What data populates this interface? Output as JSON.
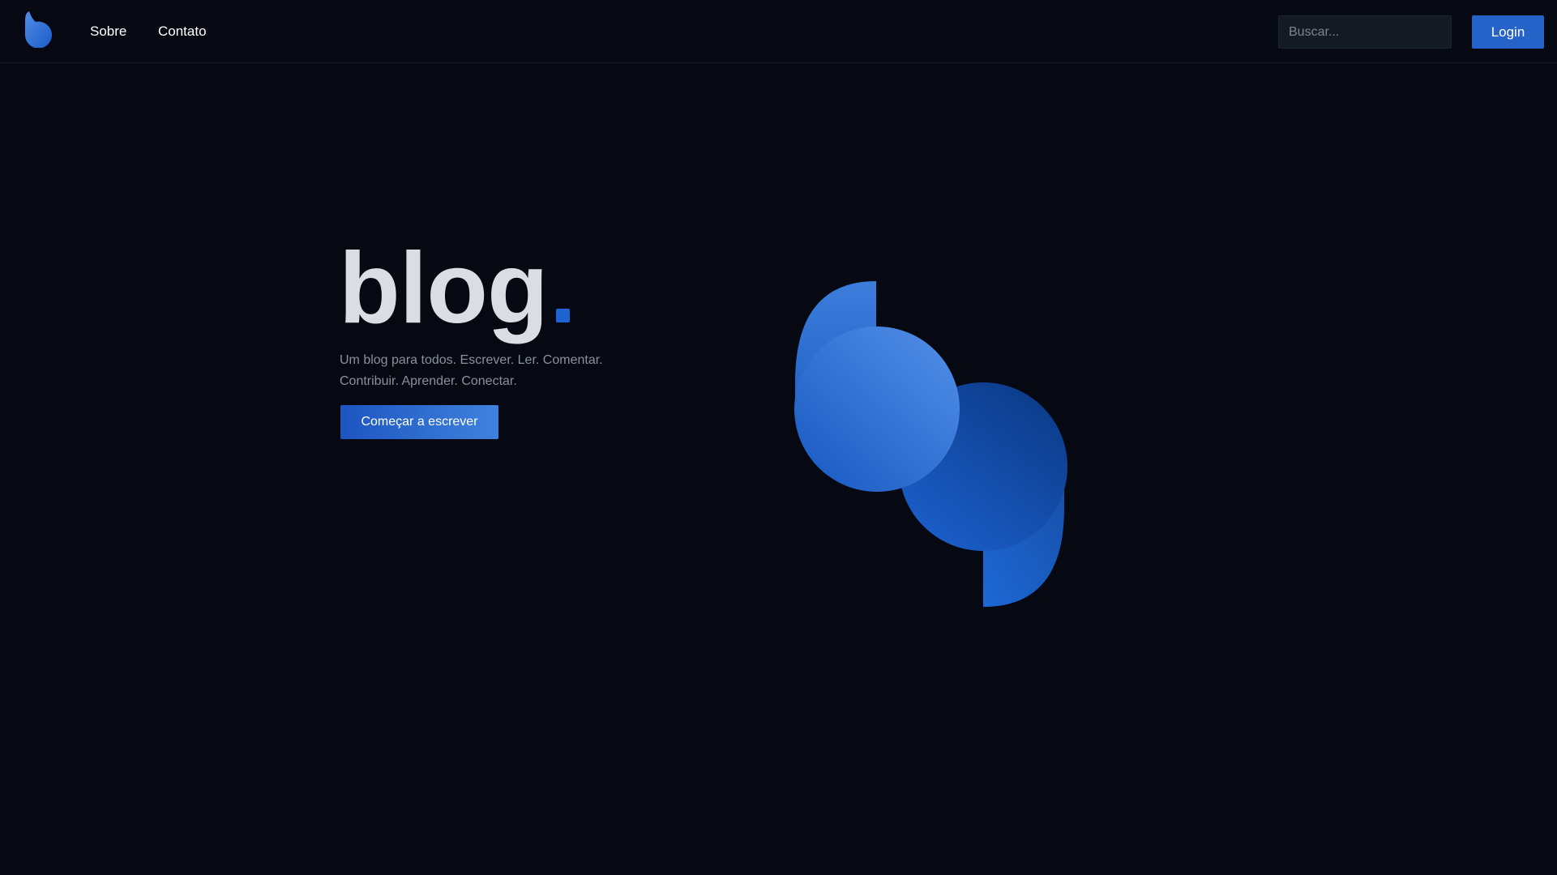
{
  "navbar": {
    "logo_icon": "blog-logo-icon",
    "links": [
      {
        "label": "Sobre"
      },
      {
        "label": "Contato"
      }
    ],
    "search": {
      "placeholder": "Buscar...",
      "value": ""
    },
    "login_label": "Login"
  },
  "hero": {
    "title": "blog",
    "tagline_line1": "Um blog para todos. Escrever. Ler. Comentar.",
    "tagline_line2": "Contribuir. Aprender. Conectar.",
    "cta_label": "Começar a escrever",
    "graphic_icon": "blog-logo-large-icon"
  },
  "colors": {
    "background": "#060912",
    "accent": "#2563c9",
    "title_text": "#dcdde3",
    "muted_text": "#8a909c"
  }
}
